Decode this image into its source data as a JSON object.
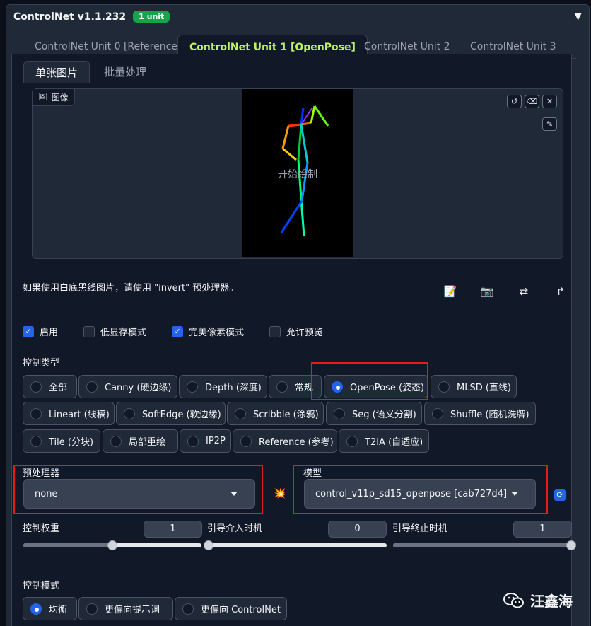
{
  "header": {
    "title": "ControlNet v1.1.232",
    "badge": "1 unit",
    "collapse_icon": "triangle-down-icon"
  },
  "unit_tabs": [
    {
      "label": "ControlNet Unit 0 [Reference]",
      "active": false
    },
    {
      "label": "ControlNet Unit 1 [OpenPose]",
      "active": true
    },
    {
      "label": "ControlNet Unit 2",
      "active": false
    },
    {
      "label": "ControlNet Unit 3",
      "active": false
    }
  ],
  "mode_tabs": [
    {
      "label": "单张图片",
      "active": true
    },
    {
      "label": "批量处理",
      "active": false
    }
  ],
  "image": {
    "label": "图像",
    "overlay_text": "开始绘制"
  },
  "hint": "如果使用白底黑线图片，请使用 \"invert\" 预处理器。",
  "checkboxes": [
    {
      "label": "启用",
      "checked": true
    },
    {
      "label": "低显存模式",
      "checked": false
    },
    {
      "label": "完美像素模式",
      "checked": true
    },
    {
      "label": "允许预览",
      "checked": false
    }
  ],
  "control_type": {
    "label": "控制类型",
    "options": [
      "全部",
      "Canny (硬边缘)",
      "Depth (深度)",
      "常规",
      "OpenPose (姿态)",
      "MLSD (直线)",
      "Lineart (线稿)",
      "SoftEdge (软边缘)",
      "Scribble (涂鸦)",
      "Seg (语义分割)",
      "Shuffle (随机洗牌)",
      "Tile (分块)",
      "局部重绘",
      "IP2P",
      "Reference (参考)",
      "T2IA (自适应)"
    ],
    "selected": "OpenPose (姿态)"
  },
  "preprocessor": {
    "label": "预处理器",
    "value": "none"
  },
  "model": {
    "label": "模型",
    "value": "control_v11p_sd15_openpose [cab727d4]"
  },
  "weights": {
    "weight_label": "控制权重",
    "weight_value": "1",
    "start_label": "引导介入时机",
    "start_value": "0",
    "end_label": "引导终止时机",
    "end_value": "1"
  },
  "sliders": {
    "weight": 0.5,
    "start": 0.0,
    "end": 1.0
  },
  "control_mode": {
    "label": "控制模式",
    "options": [
      "均衡",
      "更偏向提示词",
      "更偏向 ControlNet"
    ],
    "selected": "均衡"
  },
  "watermark": "汪鑫海",
  "colors": {
    "accent": "#2563eb",
    "active_tab": "#bef264",
    "highlight_box": "#e11d1d",
    "badge": "#16a34a"
  }
}
